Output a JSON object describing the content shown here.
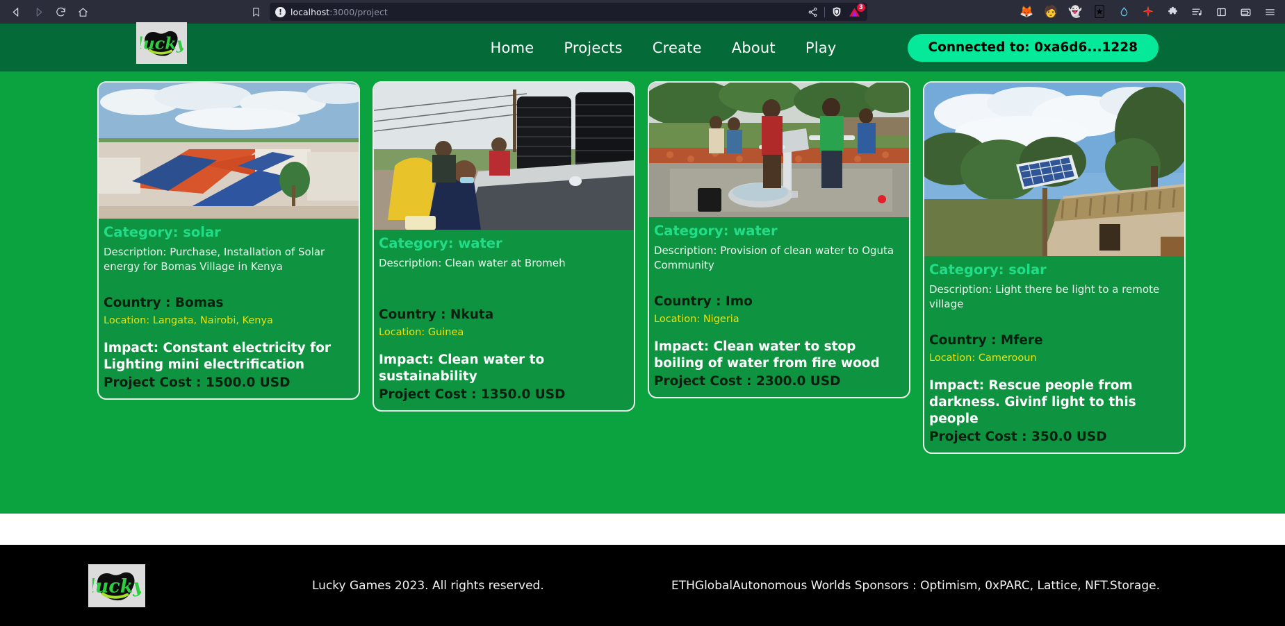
{
  "browser": {
    "back_icon": "back-arrow-icon",
    "forward_icon": "forward-arrow-icon",
    "reload_icon": "reload-icon",
    "home_icon": "home-icon",
    "bookmark_icon": "bookmark-icon",
    "url_scheme": "localhost",
    "url_path": ":3000/project",
    "url_full": "localhost:3000/project",
    "info_icon_label": "!",
    "share_icon": "share-icon",
    "shields_icon": "brave-shields-icon",
    "brave_rewards_icon": "brave-rewards-triangle-icon",
    "brave_rewards_count": "3",
    "extensions": [
      {
        "name": "metamask-fox-icon",
        "glyph": "🦊"
      },
      {
        "name": "profile-avatar-icon",
        "glyph": "🧑"
      },
      {
        "name": "ghost-extension-icon",
        "glyph": "👻"
      },
      {
        "name": "wallet-stack-icon",
        "glyph": "🃏"
      },
      {
        "name": "water-drop-icon",
        "glyph": "💧"
      },
      {
        "name": "spark-star-icon",
        "glyph": "✴"
      },
      {
        "name": "puzzle-extensions-icon",
        "glyph": "🧩"
      },
      {
        "name": "playlist-icon",
        "glyph": "☰"
      },
      {
        "name": "sidebar-toggle-icon",
        "glyph": "▭"
      },
      {
        "name": "brave-wallet-icon",
        "glyph": "💳"
      },
      {
        "name": "browser-menu-icon",
        "glyph": "≡"
      }
    ]
  },
  "header": {
    "logo_alt": "lucky",
    "nav": [
      {
        "label": "Home"
      },
      {
        "label": "Projects"
      },
      {
        "label": "Create"
      },
      {
        "label": "About"
      },
      {
        "label": "Play"
      }
    ],
    "wallet_button": "Connected to: 0xa6d6...1228",
    "brand_green": "#046a38",
    "accent_green": "#06e89a"
  },
  "projects": [
    {
      "category": "Category: solar",
      "description": "Description: Purchase, Installation of Solar energy for Bomas Village in Kenya",
      "country": "Country : Bomas",
      "location": "Location: Langata, Nairobi, Kenya",
      "impact": "Impact: Constant electricity for Lighting mini electrification",
      "cost": "Project Cost : 1500.0 USD",
      "image_alt": "solar-panels-on-village-rooftops"
    },
    {
      "category": "Category: water",
      "description": "Description: Clean water at Bromeh",
      "country": "Country : Nkuta",
      "location": "Location: Guinea",
      "impact": "Impact: Clean water to sustainability",
      "cost": "Project Cost : 1350.0 USD",
      "image_alt": "black-water-storage-tanks-commissioning"
    },
    {
      "category": "Category: water",
      "description": "Description: Provision of clean water to Oguta Community",
      "country": "Country : Imo",
      "location": "Location: Nigeria",
      "impact": "Impact: Clean water to stop boiling of water from fire wood",
      "cost": "Project Cost : 2300.0 USD",
      "image_alt": "village-hand-water-pump-with-people"
    },
    {
      "category": "Category: solar",
      "description": "Description: Light there be light to a remote village",
      "country": "Country : Mfere",
      "location": "Location: Camerooun",
      "impact": "Impact: Rescue people from darkness. Givinf light to this people",
      "cost": "Project Cost : 350.0 USD",
      "image_alt": "solar-panel-beside-thatched-roof-hut"
    }
  ],
  "footer": {
    "logo_alt": "lucky",
    "copyright": "Lucky Games 2023. All rights reserved.",
    "sponsors": "ETHGlobalAutonomous Worlds Sponsors : Optimism, 0xPARC, Lattice, NFT.Storage."
  },
  "colors": {
    "page_green": "#0aa33f",
    "card_green": "#0e9440",
    "category_text": "#22dd88",
    "location_text": "#e8e10f",
    "footer_bg": "#000000"
  }
}
